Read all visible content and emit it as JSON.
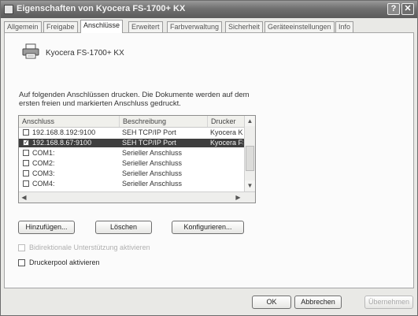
{
  "window": {
    "title": "Eigenschaften von Kyocera FS-1700+ KX"
  },
  "tabs": [
    {
      "label": "Allgemein"
    },
    {
      "label": "Freigabe"
    },
    {
      "label": "Anschlüsse"
    },
    {
      "label": "Erweitert"
    },
    {
      "label": "Farbverwaltung"
    },
    {
      "label": "Sicherheit"
    },
    {
      "label": "Geräteeinstellungen"
    },
    {
      "label": "Info"
    }
  ],
  "printer": {
    "name": "Kyocera FS-1700+ KX"
  },
  "instruction": "Auf folgenden Anschlüssen drucken. Die Dokumente werden auf dem ersten freien und markierten Anschluss gedruckt.",
  "ports": {
    "headers": {
      "port": "Anschluss",
      "description": "Beschreibung",
      "printer": "Drucker"
    },
    "rows": [
      {
        "checked": false,
        "selected": false,
        "port": "192.168.8.192:9100",
        "description": "SEH TCP/IP Port",
        "printer": "Kyocera KX"
      },
      {
        "checked": true,
        "selected": true,
        "port": "192.168.8.67:9100",
        "description": "SEH TCP/IP Port",
        "printer": "Kyocera FS"
      },
      {
        "checked": false,
        "selected": false,
        "port": "COM1:",
        "description": "Serieller Anschluss",
        "printer": ""
      },
      {
        "checked": false,
        "selected": false,
        "port": "COM2:",
        "description": "Serieller Anschluss",
        "printer": ""
      },
      {
        "checked": false,
        "selected": false,
        "port": "COM3:",
        "description": "Serieller Anschluss",
        "printer": ""
      },
      {
        "checked": false,
        "selected": false,
        "port": "COM4:",
        "description": "Serieller Anschluss",
        "printer": ""
      }
    ]
  },
  "buttons": {
    "add": "Hinzufügen...",
    "delete": "Löschen",
    "configure": "Konfigurieren...",
    "ok": "OK",
    "cancel": "Abbrechen",
    "apply": "Übernehmen"
  },
  "options": {
    "bidirectional": "Bidirektionale Unterstützung aktivieren",
    "pool": "Druckerpool aktivieren"
  },
  "icons": {
    "title": "printer-small-icon",
    "help": "help-icon",
    "close": "close-icon",
    "printer": "printer-icon"
  }
}
